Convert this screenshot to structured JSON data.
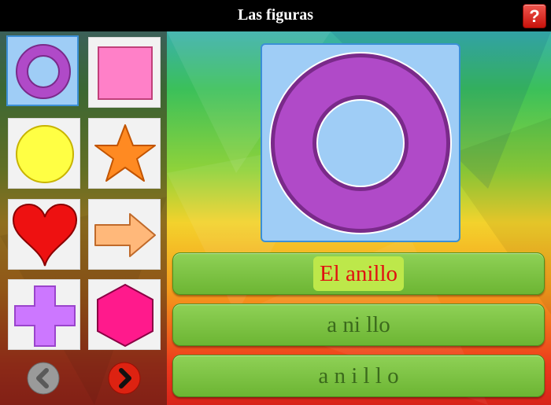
{
  "header": {
    "title": "Las figuras",
    "help_label": "?"
  },
  "shapes": [
    {
      "name": "ring",
      "selected": true,
      "color": "#b04ac8"
    },
    {
      "name": "square",
      "selected": false,
      "color": "#ff80c8"
    },
    {
      "name": "circle",
      "selected": false,
      "color": "#ffff44"
    },
    {
      "name": "star",
      "selected": false,
      "color": "#ff8a22"
    },
    {
      "name": "heart",
      "selected": false,
      "color": "#ee1111"
    },
    {
      "name": "arrow",
      "selected": false,
      "color": "#ffb87a"
    },
    {
      "name": "cross",
      "selected": false,
      "color": "#cc77ff"
    },
    {
      "name": "hexagon",
      "selected": false,
      "color": "#ff1a8c"
    }
  ],
  "nav": {
    "prev_icon": "chevron-left-icon",
    "next_icon": "chevron-right-icon",
    "prev_color": "#9a9a9a",
    "next_color": "#dd2211"
  },
  "display": {
    "shape": "ring",
    "color": "#b04ac8"
  },
  "words": [
    {
      "text": "El anillo",
      "highlight": true
    },
    {
      "text": "a ni llo",
      "highlight": false
    },
    {
      "text": "a n i l l o",
      "highlight": false
    }
  ]
}
